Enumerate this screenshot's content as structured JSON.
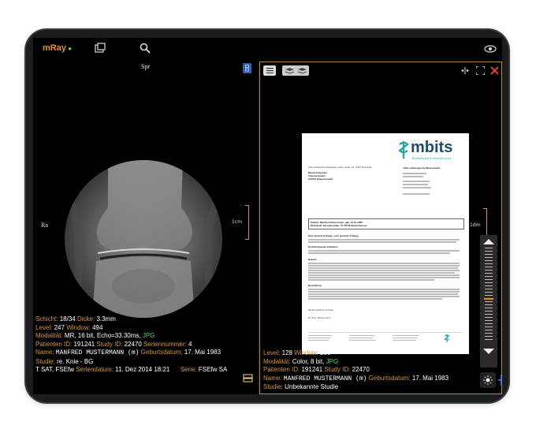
{
  "app": {
    "name": "mRay"
  },
  "left": {
    "orientation_top": "Spr",
    "orientation_left": "Ra",
    "ruler_label": "1cm",
    "info": {
      "schicht_label": "Schicht:",
      "schicht_value": "18/34",
      "dicke_label": "Dicke:",
      "dicke_value": "3.3mm",
      "level_label": "Level:",
      "level_value": "247",
      "window_label": "Window:",
      "window_value": "494",
      "modalitaet_label": "Modalität:",
      "modalitaet_value": "MR, 16 bit, Echo=33.30ms,",
      "modalitaet_tag": "JPG",
      "patid_label": "Patienten ID:",
      "patid_value": "191241",
      "studyid_label": "Study ID:",
      "studyid_value": "22470",
      "serien_label": "Seriennummer:",
      "serien_value": "4",
      "name_label": "Name:",
      "name_value": "MANFRED MUSTERMANN (m)",
      "geb_label": "Geburtsdatum:",
      "geb_value": "17. Mai 1983",
      "studie_label": "Studie:",
      "studie_value": "re. Knie - BG",
      "series_prefix": "T SAT, FSEfw",
      "seriendatum_label": "Seriendatum:",
      "seriendatum_value": "11. Dez 2014 18:21",
      "serie_label": "Serie:",
      "serie_value": "FSEfw SA"
    }
  },
  "right": {
    "ruler_label": "1dm",
    "info": {
      "level_label": "Level:",
      "level_value": "128",
      "window_label": "Window:",
      "window_value": "255",
      "modalitaet_label": "Modalität:",
      "modalitaet_value": "Color, 8 bit,",
      "modalitaet_tag": "JPG",
      "patid_label": "Patienten ID:",
      "patid_value": "191241",
      "studyid_label": "Study ID:",
      "studyid_value": "22470",
      "name_label": "Name:",
      "name_value": "MANFRED MUSTERMANN (m)",
      "geb_label": "Geburtsdatum:",
      "geb_value": "17. Mai 1983",
      "studie_label": "Studie:",
      "studie_value": "Unbekannte Studie"
    },
    "document": {
      "logo_text": "mbits",
      "logo_sub": "Radiologische Musterpraxis",
      "sender_line": "mbits radiologische Musterpraxis, Muster Straße, D2, 12345 Musterstadt",
      "recipient": [
        "Musterarztpraxis",
        "Zuweiserpraxis",
        "XXXXX Zuweiserstadt"
      ],
      "header_right": "mbits radiologische Musterpraxis",
      "patient_line1": "Patient: Manfred Mustermann, geb. 01.01.1980",
      "patient_line2": "Wohnhaft: Beispielstraße, 75 76543 Musterhausen",
      "greeting": "Sehr geehrte Kollegin, sehr geehrter Kollege,",
      "section1": "Rechtfertigende Indikation",
      "section2": "Befund",
      "section3": "Beurteilung",
      "closing": "Mit freundlichen Grüßen",
      "signer": "Dr. Prof. Mustermann"
    }
  },
  "colors": {
    "accent": "#d4962c",
    "green": "#4cd964",
    "close": "#e53935"
  },
  "icons": {
    "top": [
      "series-icon",
      "search-icon",
      "eye-icon"
    ],
    "right_toolbar": [
      "menu-icon",
      "layers-icon",
      "layers-alt-icon",
      "split-icon",
      "fullscreen-icon",
      "close-icon"
    ],
    "side": [
      "chevron-up-icon",
      "chevron-down-icon",
      "brightness-icon",
      "plus-icon"
    ]
  }
}
